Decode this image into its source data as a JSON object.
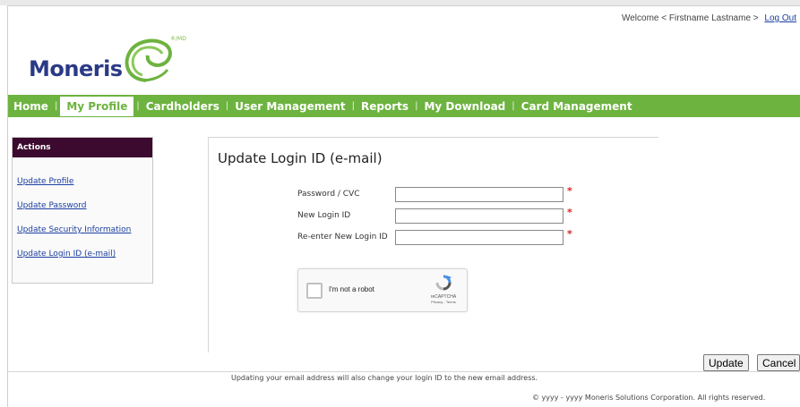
{
  "header": {
    "welcome_text": "Welcome < Firstname Lastname >",
    "logout_label": "Log Out",
    "logo_text": "Moneris",
    "logo_mark": "®/MD"
  },
  "nav": {
    "items": [
      "Home",
      "My Profile",
      "Cardholders",
      "User Management",
      "Reports",
      "My Download",
      "Card Management"
    ],
    "active": "My Profile",
    "separator": "|"
  },
  "sidebar": {
    "title": "Actions",
    "links": [
      "Update Profile",
      "Update Password",
      "Update Security Information",
      "Update Login ID (e-mail)"
    ]
  },
  "form": {
    "title": "Update Login ID (e-mail)",
    "fields": [
      {
        "label": "Password / CVC",
        "value": "",
        "required": "*"
      },
      {
        "label": "New Login ID",
        "value": "",
        "required": "*"
      },
      {
        "label": "Re-enter New Login ID",
        "value": "",
        "required": "*"
      }
    ],
    "captcha": {
      "label": "I'm not a robot",
      "brand": "reCAPTCHA",
      "links": "Privacy - Terms"
    }
  },
  "buttons": {
    "update": "Update",
    "cancel": "Cancel"
  },
  "note": "Updating your email address will also change your login ID to the new email address.",
  "footer": "© yyyy - yyyy  Moneris Solutions Corporation. All rights reserved.",
  "colors": {
    "nav_green": "#6db33f",
    "sidebar_header": "#3b0a2e",
    "link_blue": "#1b3ea0",
    "brand_navy": "#2b3a86",
    "required_red": "#e02020"
  }
}
